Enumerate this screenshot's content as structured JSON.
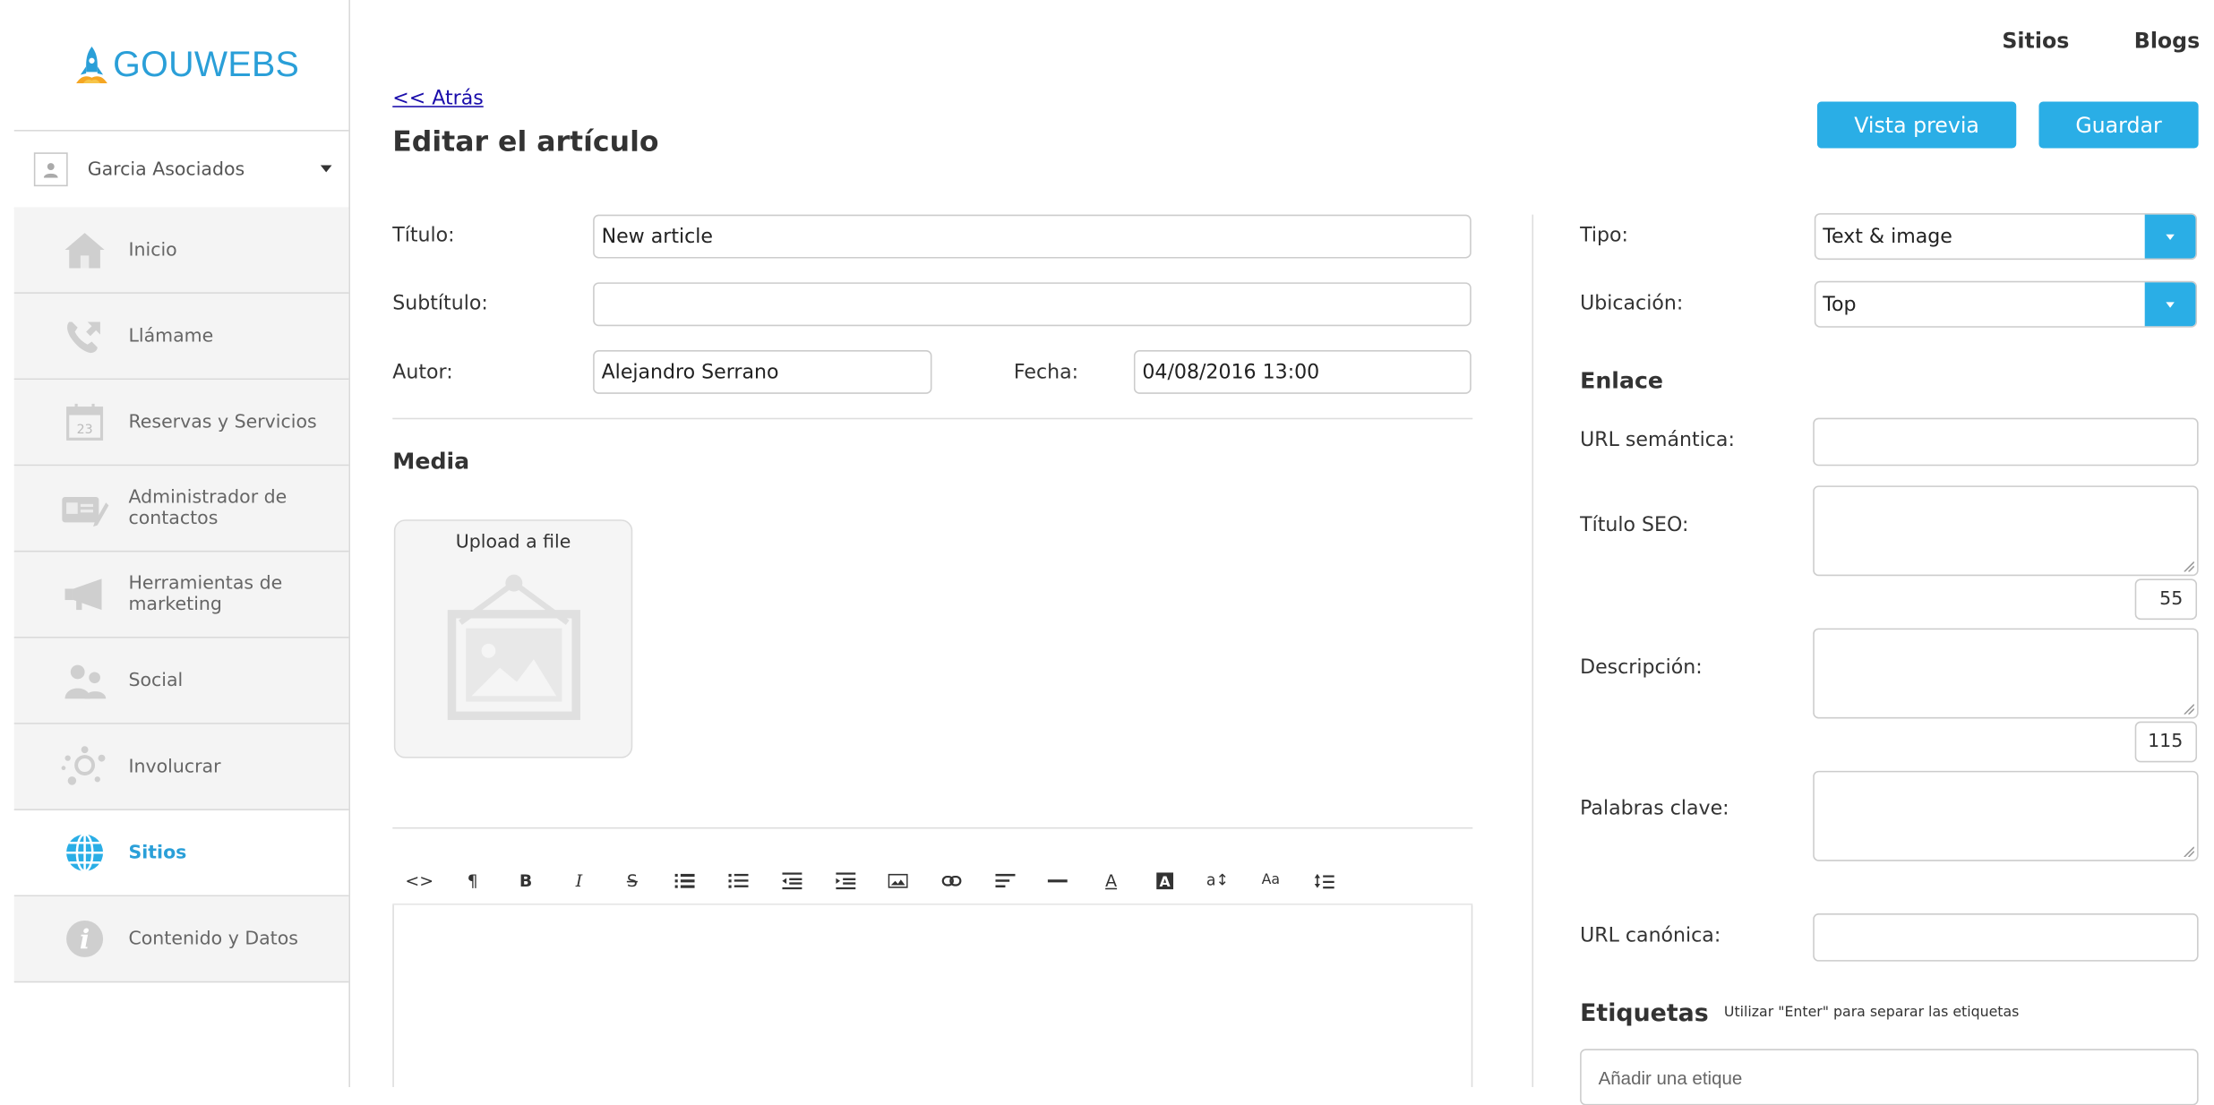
{
  "brand": {
    "name": "GOUWEBS",
    "color": "#2a9fd8"
  },
  "account": {
    "name": "Garcia Asociados"
  },
  "nav": {
    "items": [
      {
        "label": "Inicio",
        "icon": "home-icon"
      },
      {
        "label": "Llámame",
        "icon": "phone-icon"
      },
      {
        "label": "Reservas y Servicios",
        "icon": "calendar-icon",
        "calendar_day": "23"
      },
      {
        "label": "Administrador de contactos",
        "icon": "contacts-card-icon"
      },
      {
        "label": "Herramientas de marketing",
        "icon": "megaphone-icon"
      },
      {
        "label": "Social",
        "icon": "people-icon"
      },
      {
        "label": "Involucrar",
        "icon": "network-icon"
      },
      {
        "label": "Sitios",
        "icon": "globe-icon",
        "active": true
      },
      {
        "label": "Contenido y Datos",
        "icon": "info-icon"
      }
    ]
  },
  "topnav": {
    "sites": "Sitios",
    "blogs": "Blogs"
  },
  "header": {
    "back": "<< Atrás",
    "title": "Editar el artículo",
    "preview_label": "Vista previa",
    "save_label": "Guardar"
  },
  "form": {
    "title_label": "Título:",
    "title_value": "New article",
    "subtitle_label": "Subtítulo:",
    "subtitle_value": "",
    "author_label": "Autor:",
    "author_value": "Alejandro Serrano",
    "date_label": "Fecha:",
    "date_value": "04/08/2016 13:00"
  },
  "media": {
    "title": "Media",
    "upload_label": "Upload a file"
  },
  "editor": {
    "toolbar": [
      "<>",
      "¶",
      "B",
      "I",
      "S",
      "ul",
      "ol",
      "outdent",
      "indent",
      "image",
      "link",
      "align",
      "hr",
      "A",
      "A-bg",
      "a↕",
      "Aa",
      "table"
    ]
  },
  "settings": {
    "type_label": "Tipo:",
    "type_value": "Text & image",
    "location_label": "Ubicación:",
    "location_value": "Top",
    "link_section": "Enlace",
    "semantic_url_label": "URL semántica:",
    "seo_title_label": "Título SEO:",
    "seo_title_counter": "55",
    "description_label": "Descripción:",
    "description_counter": "115",
    "keywords_label": "Palabras clave:",
    "canonical_label": "URL canónica:",
    "tags_section": "Etiquetas",
    "tags_hint": "Utilizar \"Enter\" para separar las etiquetas",
    "tags_placeholder": "Añadir una etique"
  },
  "colors": {
    "accent": "#2aaee6",
    "link": "#1a0dab"
  }
}
